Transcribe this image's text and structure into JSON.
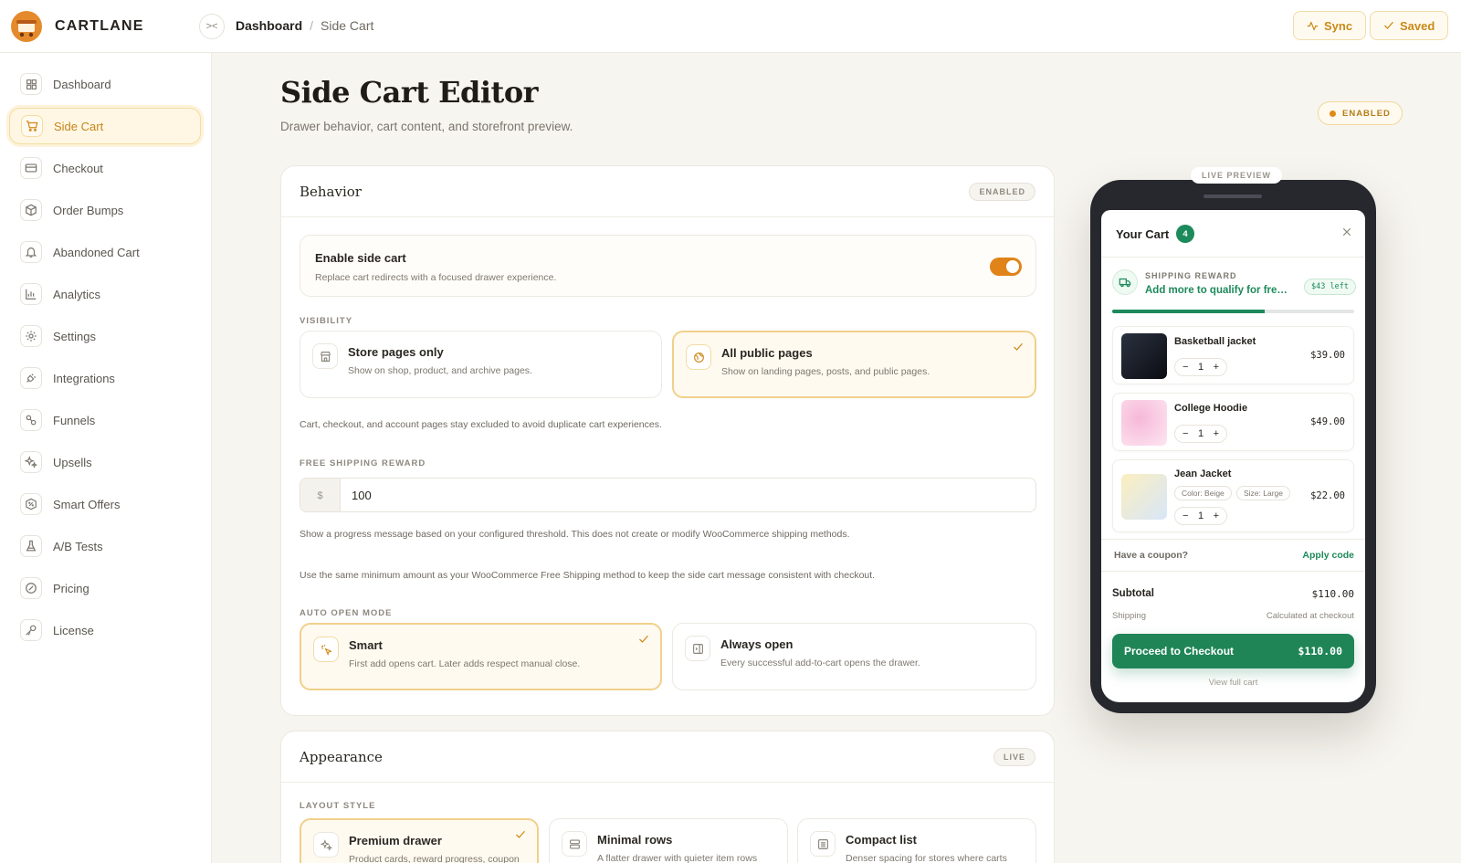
{
  "brand": {
    "name": "CARTLANE"
  },
  "breadcrumb": {
    "root": "Dashboard",
    "separator": "/",
    "current": "Side Cart"
  },
  "toolbar": {
    "sync_label": "Sync",
    "saved_label": "Saved"
  },
  "sidebar": {
    "items": [
      {
        "label": "Dashboard",
        "icon": "grid-icon",
        "active": false
      },
      {
        "label": "Side Cart",
        "icon": "cart-icon",
        "active": true
      },
      {
        "label": "Checkout",
        "icon": "credit-card-icon",
        "active": false
      },
      {
        "label": "Order Bumps",
        "icon": "box-icon",
        "active": false
      },
      {
        "label": "Abandoned Cart",
        "icon": "bell-icon",
        "active": false
      },
      {
        "label": "Analytics",
        "icon": "bar-chart-icon",
        "active": false
      },
      {
        "label": "Settings",
        "icon": "gear-icon",
        "active": false
      },
      {
        "label": "Integrations",
        "icon": "plug-icon",
        "active": false
      },
      {
        "label": "Funnels",
        "icon": "funnel-icon",
        "active": false
      },
      {
        "label": "Upsells",
        "icon": "sparkles-icon",
        "active": false
      },
      {
        "label": "Smart Offers",
        "icon": "badge-percent-icon",
        "active": false
      },
      {
        "label": "A/B Tests",
        "icon": "flask-icon",
        "active": false
      },
      {
        "label": "Pricing",
        "icon": "tag-icon",
        "active": false
      },
      {
        "label": "License",
        "icon": "key-icon",
        "active": false
      }
    ]
  },
  "page": {
    "title": "Side Cart Editor",
    "subtitle": "Drawer behavior, cart content, and storefront preview.",
    "status_badge": "ENABLED"
  },
  "behavior": {
    "title": "Behavior",
    "badge": "ENABLED",
    "enable": {
      "title": "Enable side cart",
      "description": "Replace cart redirects with a focused drawer experience.",
      "on": true
    },
    "visibility": {
      "label": "VISIBILITY",
      "options": [
        {
          "title": "Store pages only",
          "description": "Show on shop, product, and archive pages.",
          "selected": false
        },
        {
          "title": "All public pages",
          "description": "Show on landing pages, posts, and public pages.",
          "selected": true
        }
      ],
      "note": "Cart, checkout, and account pages stay excluded to avoid duplicate cart experiences."
    },
    "free_shipping": {
      "label": "FREE SHIPPING REWARD",
      "prefix": "$",
      "value": "100",
      "note1": "Show a progress message based on your configured threshold. This does not create or modify WooCommerce shipping methods.",
      "note2": "Use the same minimum amount as your WooCommerce Free Shipping method to keep the side cart message consistent with checkout."
    },
    "auto_open": {
      "label": "AUTO OPEN MODE",
      "options": [
        {
          "title": "Smart",
          "description": "First add opens cart. Later adds respect manual close.",
          "selected": true
        },
        {
          "title": "Always open",
          "description": "Every successful add-to-cart opens the drawer.",
          "selected": false
        }
      ]
    }
  },
  "appearance": {
    "title": "Appearance",
    "badge": "LIVE",
    "layout_label": "LAYOUT STYLE",
    "options": [
      {
        "title": "Premium drawer",
        "description": "Product cards, reward progress, coupon",
        "selected": true
      },
      {
        "title": "Minimal rows",
        "description": "A flatter drawer with quieter item rows",
        "selected": false
      },
      {
        "title": "Compact list",
        "description": "Denser spacing for stores where carts",
        "selected": false
      }
    ]
  },
  "preview": {
    "label": "LIVE PREVIEW",
    "cart_title": "Your Cart",
    "cart_count": "4",
    "reward_label": "SHIPPING REWARD",
    "reward_message": "Add more to qualify for free shipping",
    "reward_remaining": "$43 left",
    "reward_progress": 0.63,
    "items": [
      {
        "name": "Basketball jacket",
        "qty": "1",
        "price": "$39.00"
      },
      {
        "name": "College Hoodie",
        "qty": "1",
        "price": "$49.00"
      },
      {
        "name": "Jean Jacket",
        "qty": "1",
        "price": "$22.00",
        "chips": [
          "Color: Beige",
          "Size: Large"
        ]
      }
    ],
    "qty_minus": "−",
    "qty_plus": "+",
    "coupon_question": "Have a coupon?",
    "coupon_link": "Apply code",
    "subtotal_label": "Subtotal",
    "subtotal_value": "$110.00",
    "shipping_label": "Shipping",
    "shipping_value": "Calculated at checkout",
    "checkout_label": "Proceed to Checkout",
    "checkout_total": "$110.00",
    "view_full": "View full cart"
  },
  "colors": {
    "accent": "#e0841a",
    "green": "#1f8557",
    "bg": "#f7f5f0"
  }
}
